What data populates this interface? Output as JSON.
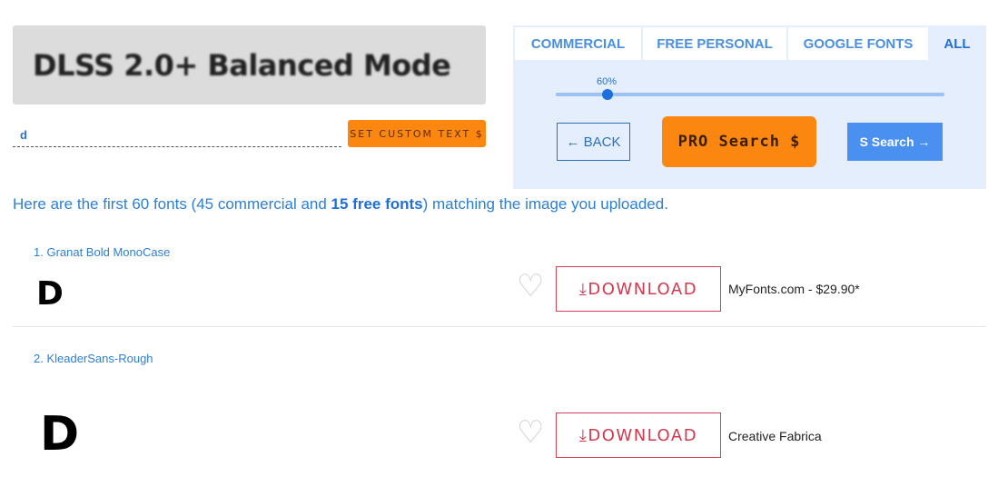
{
  "preview": {
    "text": "DLSS 2.0+ Balanced Mode"
  },
  "custom_text": {
    "value": "d",
    "button": "SET CUSTOM TEXT $"
  },
  "tabs": [
    {
      "label": "COMMERCIAL"
    },
    {
      "label": "FREE PERSONAL"
    },
    {
      "label": "GOOGLE FONTS"
    },
    {
      "label": "ALL",
      "active": true
    }
  ],
  "slider": {
    "label": "60%",
    "value": 60
  },
  "buttons": {
    "back": "← BACK",
    "pro": "PRO Search $",
    "s_search": "S Search →"
  },
  "summary": {
    "pre": "Here are the first 60 fonts (45 commercial and ",
    "bold": "15 free fonts",
    "post": ") matching the image you uploaded."
  },
  "results": [
    {
      "name": "1. Granat Bold MonoCase",
      "glyph": "D",
      "download": "DOWNLOAD",
      "vendor": "MyFonts.com - $29.90*"
    },
    {
      "name": "2. KleaderSans-Rough",
      "glyph": "D",
      "download": "DOWNLOAD",
      "vendor": "Creative Fabrica"
    }
  ],
  "icons": {
    "favorite": "heart-outline-icon",
    "download": "download-icon"
  },
  "colors": {
    "accent_orange": "#fb8711",
    "link_blue": "#2c7fd6",
    "download_red": "#d2394f"
  }
}
